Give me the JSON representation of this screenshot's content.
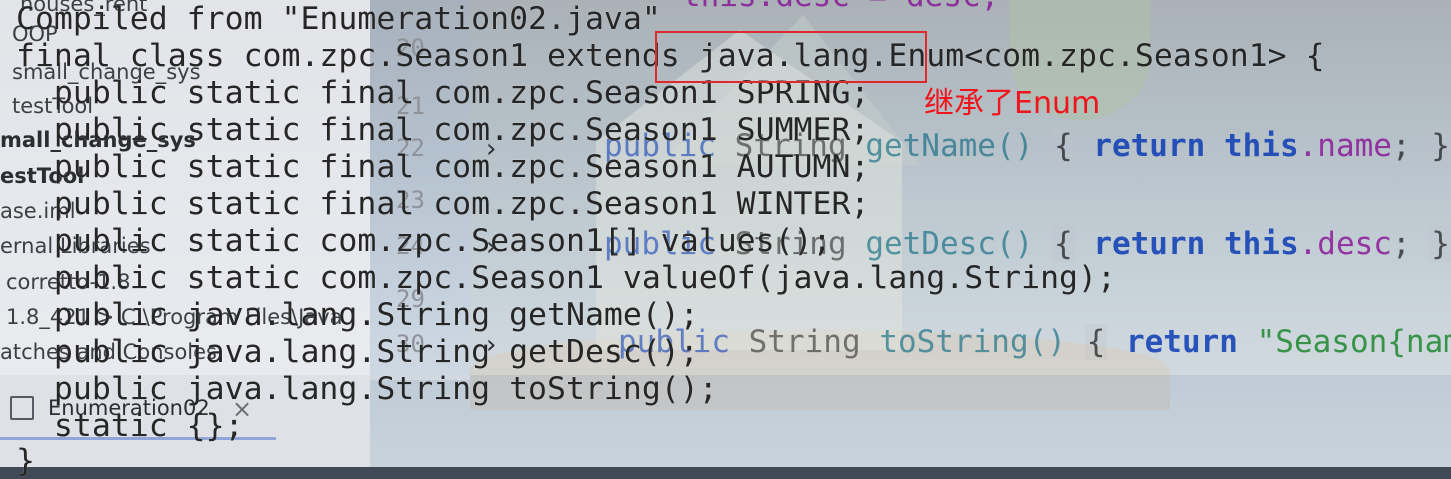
{
  "sidebar": {
    "items": [
      {
        "label": "houses_rent"
      },
      {
        "label": "OOP"
      },
      {
        "label": "small_change_sys"
      },
      {
        "label": "testTool"
      },
      {
        "label": "mall_change_sys"
      },
      {
        "label": "estTool"
      },
      {
        "label": "ase.iml"
      },
      {
        "label": "ernal Libraries"
      },
      {
        "label": "corretto-1.8"
      },
      {
        "label": "1.8_421 > C:\\Program Files\\Java"
      },
      {
        "label": "atches and Consoles"
      }
    ]
  },
  "gutter": {
    "line_numbers": [
      "20",
      "21",
      "22",
      "23",
      "24",
      "29",
      "30"
    ]
  },
  "editor": {
    "line_top": "this.desc = desc;",
    "getName": {
      "mod": "public",
      "type": "String",
      "name": "getName()",
      "brace_open": "{",
      "ret": "return",
      "this": "this",
      "field": ".name",
      "end": ";",
      "brace_close": "}"
    },
    "getDesc": {
      "mod": "public",
      "type": "String",
      "name": "getDesc()",
      "brace_open": "{",
      "ret": "return",
      "this": "this",
      "field": ".desc",
      "end": ";",
      "brace_close": "}"
    },
    "toString": {
      "mod": "public",
      "type": "String",
      "name": "toString()",
      "brace_open": "{",
      "ret": "return",
      "str": "\"Season{nam"
    }
  },
  "console_tab": {
    "label": "Enumeration02",
    "close": "×"
  },
  "javap_output": {
    "lines": [
      "Compiled from \"Enumeration02.java\"",
      "final class com.zpc.Season1 extends java.lang.Enum<com.zpc.Season1> {",
      "  public static final com.zpc.Season1 SPRING;",
      "  public static final com.zpc.Season1 SUMMER;",
      "  public static final com.zpc.Season1 AUTUMN;",
      "  public static final com.zpc.Season1 WINTER;",
      "  public static com.zpc.Season1[] values();",
      "  public static com.zpc.Season1 valueOf(java.lang.String);",
      "  public java.lang.String getName();",
      "  public java.lang.String getDesc();",
      "  public java.lang.String toString();",
      "  static {};",
      "}"
    ]
  },
  "annotation": {
    "text": "继承了Enum",
    "color": "#f0141c"
  },
  "colors": {
    "keyword": "#0033b3",
    "field": "#871094",
    "string": "#067d17",
    "annotation_border": "#e0292b"
  }
}
